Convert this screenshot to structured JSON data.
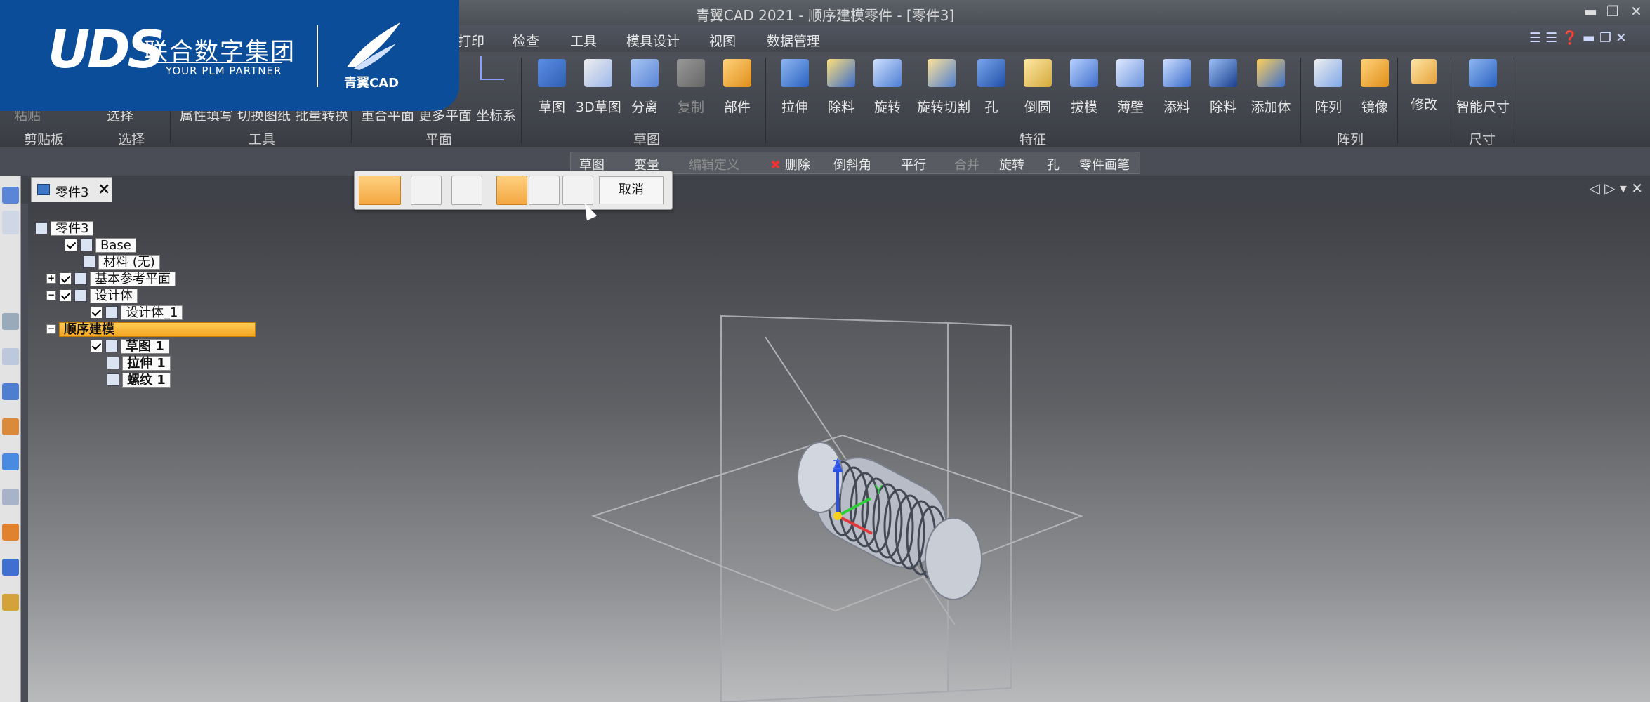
{
  "window": {
    "title": "青翼CAD 2021 - 顺序建模零件 - [零件3]"
  },
  "logo": {
    "brand": "UDS",
    "company_cn": "联合数字集团",
    "tagline": "YOUR PLM PARTNER",
    "product": "青翼CAD"
  },
  "menu": [
    "打印",
    "检查",
    "工具",
    "模具设计",
    "视图",
    "数据管理"
  ],
  "ribbon": {
    "left_labels": {
      "paste": "粘贴",
      "select": "选择",
      "tools_row": "属性填写 切换图纸 批量转换",
      "planes_row": "重合平面 更多平面 坐标系"
    },
    "sketch_group": [
      "草图",
      "3D草图",
      "分离",
      "复制",
      "部件"
    ],
    "feature_group": [
      "拉伸",
      "除料",
      "旋转",
      "旋转切割",
      "孔",
      "倒圆",
      "拔模",
      "薄壁",
      "添料",
      "除料",
      "添加体"
    ],
    "pattern_group": [
      "阵列",
      "镜像"
    ],
    "modify": "修改",
    "dimension": "智能尺寸",
    "group_labels": {
      "clipboard": "剪贴板",
      "select": "选择",
      "tools": "工具",
      "plane": "平面",
      "sketch": "草图",
      "feature": "特征",
      "pattern": "阵列",
      "dim": "尺寸"
    }
  },
  "context_bar": [
    "草图",
    "变量",
    "编辑定义",
    "删除",
    "倒斜角",
    "平行",
    "合并",
    "旋转",
    "孔",
    "零件画笔"
  ],
  "tab": {
    "label": "零件3"
  },
  "tree": {
    "root": "零件3",
    "base": "Base",
    "material": "材料 (无)",
    "ref_planes": "基本参考平面",
    "design_body": "设计体",
    "design_body_1": "设计体_1",
    "sequential": "顺序建模",
    "sketch1": "草图 1",
    "extrude1": "拉伸 1",
    "thread1": "螺纹 1"
  },
  "popup": {
    "cancel": "取消"
  },
  "triad": {
    "z": "Z",
    "y": "Y"
  }
}
